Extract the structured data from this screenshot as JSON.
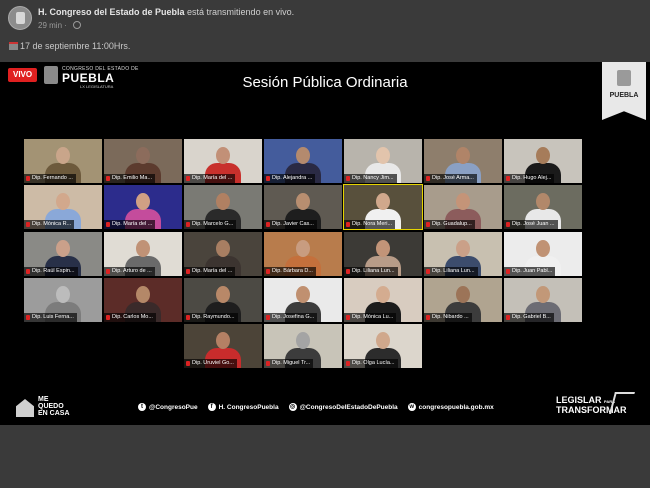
{
  "post": {
    "page_name": "H. Congreso del Estado de Puebla",
    "action": " está transmitiendo en vivo.",
    "time_ago": "29 min",
    "date": "17 de septiembre 11:00Hrs."
  },
  "video": {
    "live_label": "VIVO",
    "brand_top": "CONGRESO DEL ESTADO DE",
    "brand_main": "PUEBLA",
    "brand_sub": "LX LEGISLATURA",
    "session_title": "Sesión Pública Ordinaria",
    "banner_text": "PUEBLA",
    "tiles": [
      {
        "label": "Dip. Fernando ...",
        "face": "#c9a58a",
        "shirt": "#6d5a3c",
        "bg": "#a39374"
      },
      {
        "label": "Dip. Emilio Ma...",
        "face": "#8c6c5c",
        "shirt": "#5c3b2e",
        "bg": "#7b6a5a"
      },
      {
        "label": "Dip. María del ...",
        "face": "#c29077",
        "shirt": "#c8302c",
        "bg": "#d9d4cc"
      },
      {
        "label": "Dip. Alejandra ...",
        "face": "#b48a6e",
        "shirt": "#2a2a44",
        "bg": "#445c9c"
      },
      {
        "label": "Dip. Nancy Jim...",
        "face": "#e2c4ac",
        "shirt": "#e8e8e8",
        "bg": "#b8b4ac"
      },
      {
        "label": "Dip. José Arma...",
        "face": "#b08468",
        "shirt": "#8aa0c4",
        "bg": "#8e7e6c"
      },
      {
        "label": "Dip. Hugo Alej...",
        "face": "#a67c5a",
        "shirt": "#1a1a1a",
        "bg": "#c8c4bc"
      },
      {
        "label": "Dip. Mónica R...",
        "face": "#d2a88c",
        "shirt": "#8aa8d8",
        "bg": "#cdbba6"
      },
      {
        "label": "Dip. María del ...",
        "face": "#d0a084",
        "shirt": "#c44c9c",
        "bg": "#2c2c8c"
      },
      {
        "label": "Dip. Marcelo G...",
        "face": "#b08062",
        "shirt": "#2a2a2a",
        "bg": "#7a7a74"
      },
      {
        "label": "Dip. Javier Cas...",
        "face": "#b88e70",
        "shirt": "#1e1e1e",
        "bg": "#5f5a52"
      },
      {
        "label": "Dip. Nora Meri...",
        "face": "#d0a88c",
        "shirt": "#f0f0f0",
        "bg": "#58503c"
      },
      {
        "label": "Dip. Guadalup...",
        "face": "#c49478",
        "shirt": "#8c5c5c",
        "bg": "#a89c8c"
      },
      {
        "label": "Dip. José Juan ...",
        "face": "#b2886a",
        "shirt": "#e8e8e8",
        "bg": "#6c6c60"
      },
      {
        "label": "Dip. Raúl Espin...",
        "face": "#caa08a",
        "shirt": "#283048",
        "bg": "#8a8a86"
      },
      {
        "label": "Dip. Arturo de ...",
        "face": "#c09276",
        "shirt": "#6a6a6a",
        "bg": "#e0dcd4"
      },
      {
        "label": "Dip. María del ...",
        "face": "#a87e62",
        "shirt": "#3c3430",
        "bg": "#4a443c"
      },
      {
        "label": "Dip. Bárbara D...",
        "face": "#c89c80",
        "shirt": "#c4703c",
        "bg": "#b87c4c"
      },
      {
        "label": "Dip. Liliana Lun...",
        "face": "#c29478",
        "shirt": "#b89c88",
        "bg": "#3c3a36"
      },
      {
        "label": "Dip. Liliana Lun...",
        "face": "#caa088",
        "shirt": "#3c4c6c",
        "bg": "#c8c0b0"
      },
      {
        "label": "Dip. Juan Pabl...",
        "face": "#c09274",
        "shirt": "#f0f0f0",
        "bg": "#ececec"
      },
      {
        "label": "Dip. Luis Ferna...",
        "face": "#bcbcbc",
        "shirt": "#7c7c7c",
        "bg": "#9c9c9c"
      },
      {
        "label": "Dip. Carlos Mo...",
        "face": "#b48868",
        "shirt": "#3a2a2a",
        "bg": "#5c2c28"
      },
      {
        "label": "Dip. Raymundo...",
        "face": "#b88868",
        "shirt": "#1e1e1e",
        "bg": "#4c4a44"
      },
      {
        "label": "Dip. Josefina G...",
        "face": "#c09070",
        "shirt": "#3c3c3c",
        "bg": "#eaeaea"
      },
      {
        "label": "Dip. Mónica Lu...",
        "face": "#d4ac90",
        "shirt": "#1c1c1c",
        "bg": "#d8ccc0"
      },
      {
        "label": "Dip. Nibardo ...",
        "face": "#9c7458",
        "shirt": "#3c3c3c",
        "bg": "#b0a490"
      },
      {
        "label": "Dip. Gabriel B...",
        "face": "#c29878",
        "shirt": "#6c6c74",
        "bg": "#c4c0b8"
      },
      {
        "label": "Dip. Uruviel Go...",
        "face": "#b48064",
        "shirt": "#c82c2c",
        "bg": "#4c4438"
      },
      {
        "label": "Dip. Miguel Tr...",
        "face": "#a4a4a4",
        "shirt": "#3c3c3c",
        "bg": "#c8c4b8"
      },
      {
        "label": "Dip. Olga Lucía...",
        "face": "#d0a88c",
        "shirt": "#2c2c2c",
        "bg": "#dcd6cc"
      }
    ],
    "footer": {
      "me_quedo": [
        "ME",
        "QUEDO",
        "EN CASA"
      ],
      "socials": [
        {
          "icon": "twitter-icon",
          "glyph": "t",
          "text": "@CongresoPue"
        },
        {
          "icon": "facebook-icon",
          "glyph": "f",
          "text": "H. CongresoPuebla"
        },
        {
          "icon": "instagram-icon",
          "glyph": "◎",
          "text": "@CongresoDelEstadoDePuebla"
        },
        {
          "icon": "web-icon",
          "glyph": "w",
          "text": "congresopuebla.gob.mx"
        }
      ],
      "legislar_1": "LEGISLAR",
      "legislar_para": "PARA",
      "legislar_2": "TRANSFORMAR"
    }
  }
}
